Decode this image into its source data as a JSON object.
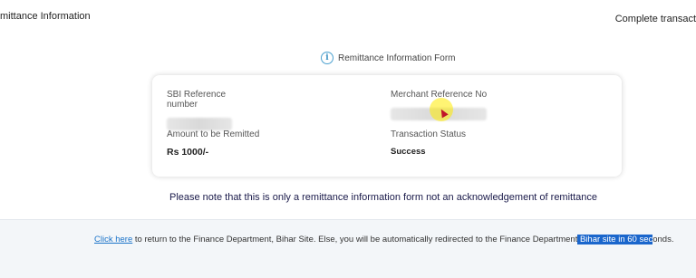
{
  "header": {
    "left_title": "mittance Information",
    "right_text": "Complete transact"
  },
  "form": {
    "title": "Remittance Information Form",
    "info_icon": "i",
    "fields": {
      "sbi_ref_label": "SBI Reference number",
      "merchant_ref_label": "Merchant Reference No",
      "amount_label": "Amount to be Remitted",
      "amount_value": "Rs 1000/-",
      "status_label": "Transaction Status",
      "status_value": "Success"
    }
  },
  "notice": "Please note that this is only a remittance information form not an acknowledgement of remittance",
  "footer": {
    "link": "Click here",
    "text_before_highlight": " to return to the Finance Department, Bihar Site. Else, you will be automatically redirected to the Finance Department",
    "highlighted": " Bihar site in 60 sec",
    "text_after_highlight": "onds."
  },
  "colors": {
    "link": "#1a73c9",
    "highlight": "#1a66cc",
    "info_icon": "#4aa0cf"
  }
}
